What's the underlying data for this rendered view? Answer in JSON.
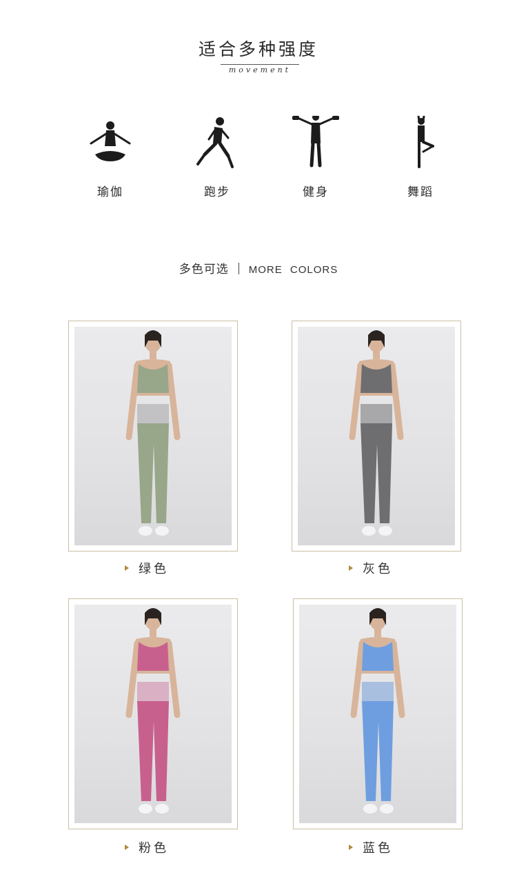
{
  "intensity": {
    "title": "适合多种强度",
    "subtitle": "movement",
    "activities": [
      {
        "label": "瑜伽",
        "icon": "yoga-pose-icon"
      },
      {
        "label": "跑步",
        "icon": "running-icon"
      },
      {
        "label": "健身",
        "icon": "dumbbell-fitness-icon"
      },
      {
        "label": "舞蹈",
        "icon": "dance-pose-icon"
      }
    ]
  },
  "colors_section": {
    "title_cn": "多色可选",
    "title_en": "MORE COLORS"
  },
  "products": [
    {
      "label": "绿色",
      "color": "#98a68a"
    },
    {
      "label": "灰色",
      "color": "#6e6e70"
    },
    {
      "label": "粉色",
      "color": "#c8608e"
    },
    {
      "label": "蓝色",
      "color": "#6e9ee0"
    }
  ],
  "colors": {
    "frame": "#c9bfa3",
    "bullet": "#b08a3a",
    "text": "#333333"
  }
}
